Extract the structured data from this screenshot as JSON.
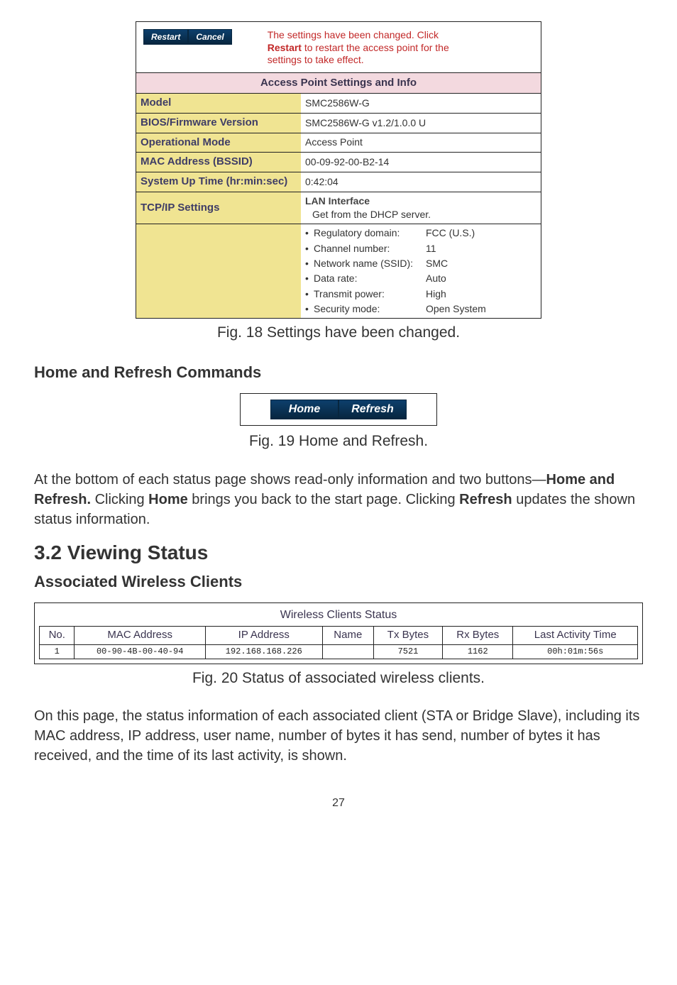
{
  "page_number": "27",
  "fig18": {
    "restart_btn": "Restart",
    "cancel_btn": "Cancel",
    "msg_pre": "The settings have been changed. Click ",
    "msg_bold": "Restart",
    "msg_post": " to restart the access point for the settings to take effect.",
    "header": "Access Point Settings and Info",
    "rows": {
      "model_l": "Model",
      "model_v": "SMC2586W-G",
      "bios_l": "BIOS/Firmware Version",
      "bios_v": "SMC2586W-G v1.2/1.0.0 U",
      "mode_l": "Operational Mode",
      "mode_v": "Access Point",
      "mac_l": "MAC Address (BSSID)",
      "mac_v": "00-09-92-00-B2-14",
      "uptime_l": "System Up Time (hr:min:sec)",
      "uptime_v": "0:42:04",
      "tcp_l": "TCP/IP Settings",
      "tcp_title": "LAN Interface",
      "tcp_sub": "Get from the DHCP server."
    },
    "specs": {
      "reg_l": "Regulatory domain:",
      "reg_v": "FCC (U.S.)",
      "chan_l": "Channel number:",
      "chan_v": "11",
      "ssid_l": "Network name (SSID):",
      "ssid_v": "SMC",
      "rate_l": "Data rate:",
      "rate_v": "Auto",
      "pow_l": "Transmit power:",
      "pow_v": "High",
      "sec_l": "Security mode:",
      "sec_v": "Open System"
    },
    "caption": "Fig. 18 Settings have been changed."
  },
  "homeRefresh": {
    "heading": "Home and Refresh Commands",
    "home_btn": "Home",
    "refresh_btn": "Refresh",
    "caption": "Fig. 19 Home and Refresh.",
    "para_pre": "At the bottom of each status page shows read-only information and two buttons—",
    "para_bold1": "Home and Refresh.",
    "para_mid": " Clicking ",
    "para_bold2": "Home",
    "para_mid2": " brings you back to the start page. Clicking ",
    "para_bold3": "Refresh",
    "para_post": " updates the shown status information."
  },
  "sec32": {
    "heading": "3.2 Viewing Status",
    "subhead": "Associated Wireless Clients",
    "tbl_title": "Wireless Clients Status",
    "cols": {
      "no": "No.",
      "mac": "MAC Address",
      "ip": "IP Address",
      "name": "Name",
      "tx": "Tx Bytes",
      "rx": "Rx Bytes",
      "last": "Last Activity Time"
    },
    "rows": [
      {
        "no": "1",
        "mac": "00-90-4B-00-40-94",
        "ip": "192.168.168.226",
        "name": "",
        "tx": "7521",
        "rx": "1162",
        "last": "00h:01m:56s"
      }
    ],
    "caption": "Fig. 20 Status of associated wireless clients.",
    "para": "On this page, the status information of each associated client (STA or Bridge Slave), including its MAC address, IP address, user name, number of bytes it has send, number of bytes it has received, and the time of its last activity, is shown."
  }
}
